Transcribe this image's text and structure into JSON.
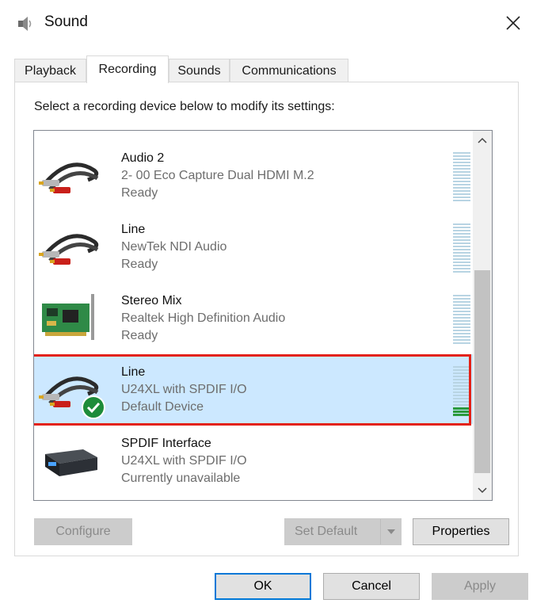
{
  "window": {
    "title": "Sound",
    "icon": "speaker-icon",
    "close_icon": "close-icon"
  },
  "tabs": [
    {
      "label": "Playback",
      "active": false
    },
    {
      "label": "Recording",
      "active": true
    },
    {
      "label": "Sounds",
      "active": false
    },
    {
      "label": "Communications",
      "active": false
    }
  ],
  "panel": {
    "instruction": "Select a recording device below to modify its settings:"
  },
  "devices": [
    {
      "name": "Audio 2",
      "description": "2- 00 Eco Capture Dual HDMI M.2",
      "status": "Ready",
      "icon": "rca-cable-icon",
      "selected": false,
      "default": false,
      "level": 0
    },
    {
      "name": "Line",
      "description": "NewTek NDI Audio",
      "status": "Ready",
      "icon": "rca-cable-icon",
      "selected": false,
      "default": false,
      "level": 0
    },
    {
      "name": "Stereo Mix",
      "description": "Realtek High Definition Audio",
      "status": "Ready",
      "icon": "sound-card-icon",
      "selected": false,
      "default": false,
      "level": 0
    },
    {
      "name": "Line",
      "description": "U24XL with SPDIF I/O",
      "status": "Default Device",
      "icon": "rca-cable-icon",
      "selected": true,
      "default": true,
      "level": 0.2
    },
    {
      "name": "SPDIF Interface",
      "description": "U24XL with SPDIF I/O",
      "status": "Currently unavailable",
      "icon": "audio-interface-icon",
      "selected": false,
      "default": false,
      "level": 0
    }
  ],
  "buttons": {
    "configure": "Configure",
    "set_default": "Set Default",
    "properties": "Properties",
    "ok": "OK",
    "cancel": "Cancel",
    "apply": "Apply"
  },
  "colors": {
    "selection_bg": "#cce8ff",
    "highlight_outline": "#e32217",
    "default_check": "#1e8c3a",
    "meter_on": "#2b9a3d",
    "meter_off": "#b8d4e3",
    "primary_border": "#0078d7"
  }
}
